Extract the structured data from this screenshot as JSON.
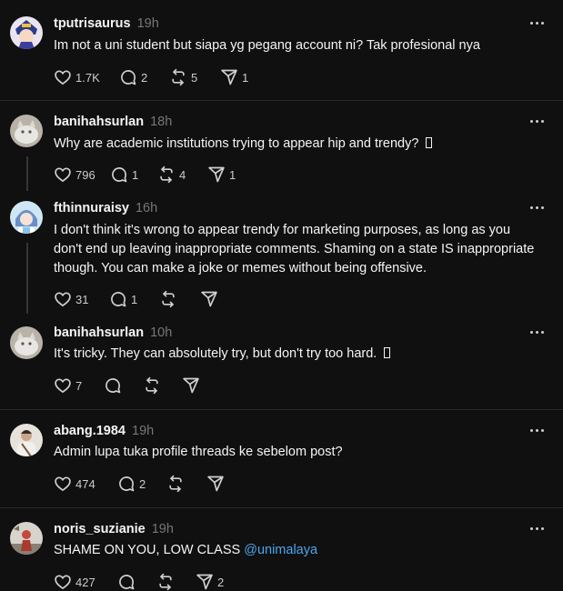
{
  "posts": [
    {
      "username": "tputrisaurus",
      "time": "19h",
      "text": "Im not a uni student but siapa yg pegang account ni? Tak profesional nya",
      "likes": "1.7K",
      "replies": "2",
      "reposts": "5",
      "shares": "1",
      "avatar_icon": "anime-avatar-icon"
    },
    {
      "username": "banihahsurlan",
      "time": "18h",
      "text": "Why are academic institutions trying to appear hip and trendy? ",
      "likes": "796",
      "replies": "1",
      "reposts": "4",
      "shares": "1",
      "avatar_icon": "cat-avatar-icon"
    },
    {
      "username": "fthinnuraisy",
      "time": "16h",
      "text": "I don't think it's wrong to appear trendy for marketing purposes, as long as you don't end up leaving inappropriate comments. Shaming on a state IS inappropriate though. You can make a joke or memes without being offensive.",
      "likes": "31",
      "replies": "1",
      "reposts": "",
      "shares": "",
      "avatar_icon": "illustrated-avatar-icon"
    },
    {
      "username": "banihahsurlan",
      "time": "10h",
      "text": "It's tricky. They can absolutely try, but don't try too hard. ",
      "likes": "7",
      "replies": "",
      "reposts": "",
      "shares": "",
      "avatar_icon": "cat-avatar-icon"
    },
    {
      "username": "abang.1984",
      "time": "19h",
      "text": "Admin lupa tuka profile threads ke sebelom post?",
      "likes": "474",
      "replies": "2",
      "reposts": "",
      "shares": "",
      "avatar_icon": "person-avatar-icon"
    },
    {
      "username": "noris_suzianie",
      "time": "19h",
      "text": "SHAME ON YOU, LOW CLASS ",
      "mention": "@unimalaya",
      "likes": "427",
      "replies": "",
      "reposts": "",
      "shares": "2",
      "avatar_icon": "photo-avatar-icon"
    }
  ],
  "colors": {
    "background": "#101010",
    "text": "#f3f5f7",
    "muted": "#777777",
    "divider": "#2a2a2a",
    "link": "#4aa7f0"
  }
}
